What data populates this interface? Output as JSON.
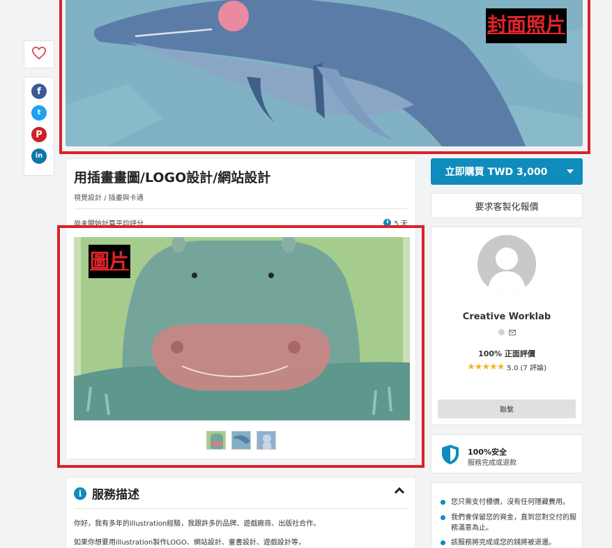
{
  "annotations": {
    "cover_label": "封面照片",
    "gallery_label": "圖片"
  },
  "share": {
    "icons": [
      "heart-icon",
      "facebook-icon",
      "twitter-icon",
      "pinterest-icon",
      "linkedin-icon"
    ],
    "facebook_glyph": "f",
    "twitter_glyph": "t",
    "pinterest_glyph": "P",
    "linkedin_glyph": "in"
  },
  "service": {
    "title": "用插畫畫圖/LOGO設計/網站設計",
    "category": "視覺設計 / 插畫與卡通",
    "rating_note": "尚未開始計算平均評分",
    "delivery": "5 天",
    "thumbnail_count": 3
  },
  "description": {
    "heading": "服務描述",
    "paragraphs": [
      "你好，我有多年的illustration經驗，我跟許多的品牌、遊戲廠商、出版社合作。",
      "如果你想要用illustration製作LOGO、網站設計、童書設計、遊戲設計等，"
    ]
  },
  "purchase": {
    "buy_label": "立即購買 TWD 3,000",
    "quote_label": "要求客製化報價"
  },
  "seller": {
    "name": "Creative Worklab",
    "positive": "100% 正面評價",
    "stars": "★★★★★",
    "rating_text": "5.0 (7 評論)",
    "contact_label": "聯繫"
  },
  "security": {
    "title": "100%安全",
    "subtitle": "服務完成或退款"
  },
  "assurances": [
    "您只需支付標價，沒有任何隱藏費用。",
    "我們會保留您的資金，直到您對交付的服務滿意為止。",
    "該服務將完成或您的錢將被退還。"
  ],
  "colors": {
    "accent": "#0f8bbd",
    "annotation_red": "#d8232a",
    "star": "#f5b324",
    "background": "#f2f3f5"
  }
}
